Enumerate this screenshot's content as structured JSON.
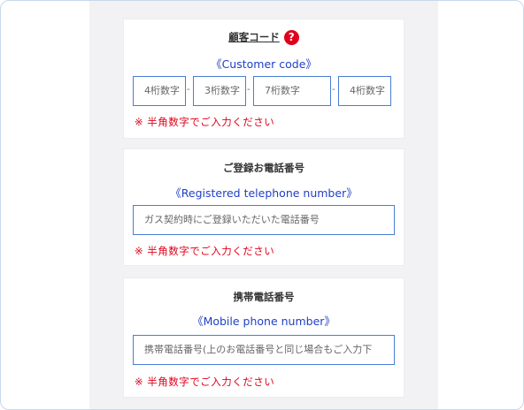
{
  "customer_code": {
    "title": "顧客コード",
    "help_icon": "question-circle-icon",
    "subtitle": "《Customer code》",
    "fields": [
      {
        "placeholder": "4桁数字"
      },
      {
        "placeholder": "3桁数字"
      },
      {
        "placeholder": "7桁数字"
      },
      {
        "placeholder": "4桁数字"
      }
    ],
    "separators": [
      "-",
      "-",
      "-"
    ],
    "note": "※ 半角数字でご入力ください"
  },
  "registered_phone": {
    "title": "ご登録お電話番号",
    "subtitle": "《Registered telephone number》",
    "placeholder": "ガス契約時にご登録いただいた電話番号",
    "note": "※ 半角数字でご入力ください"
  },
  "mobile_phone": {
    "title": "携帯電話番号",
    "subtitle": "《Mobile phone number》",
    "placeholder": "携帯電話番号(上のお電話番号と同じ場合もご入力下",
    "note": "※ 半角数字でご入力ください"
  },
  "colors": {
    "accent_blue": "#1f3fc8",
    "input_border": "#4a7ed3",
    "error_red": "#e0001a",
    "panel_bg": "#f2f2f4"
  }
}
